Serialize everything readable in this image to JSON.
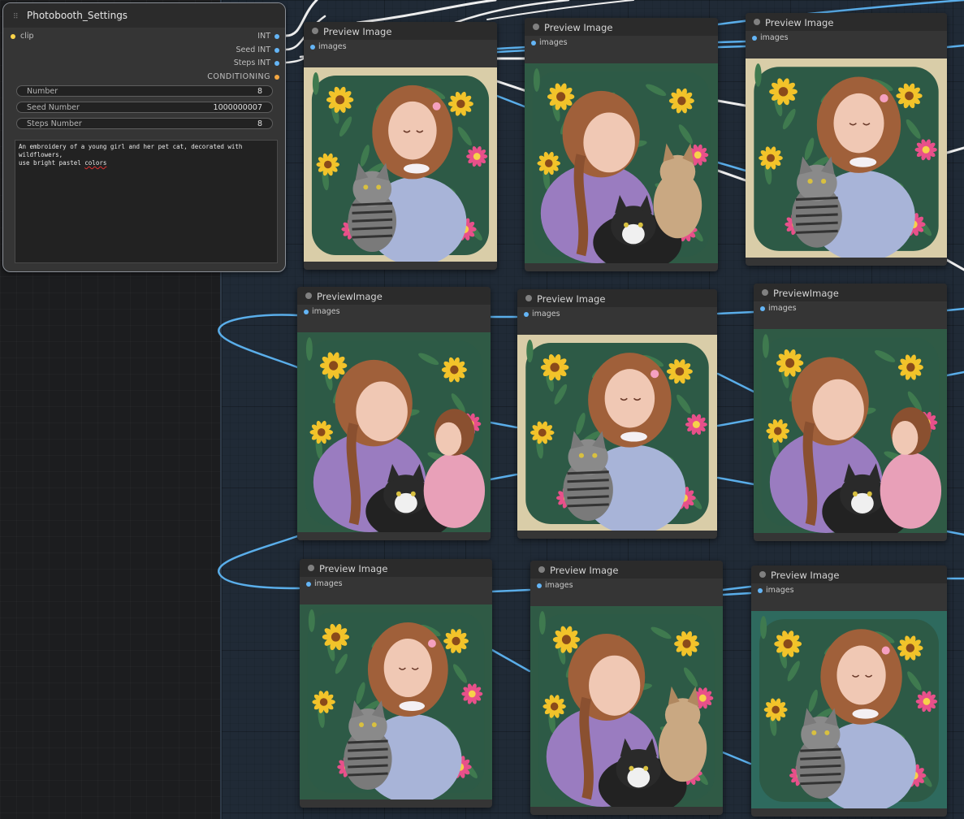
{
  "settings_node": {
    "title": "Photobooth_Settings",
    "input_port": "clip",
    "outputs": [
      "INT",
      "Seed INT",
      "Steps INT",
      "CONDITIONING"
    ],
    "widgets": [
      {
        "label": "Number",
        "value": "8"
      },
      {
        "label": "Seed Number",
        "value": "1000000007"
      },
      {
        "label": "Steps Number",
        "value": "8"
      }
    ],
    "prompt_line1": "An embroidery of a young girl and her pet cat, decorated with wildflowers,",
    "prompt_line2_pre": "use bright pastel ",
    "prompt_line2_err": "colors"
  },
  "preview_nodes": [
    {
      "title": "Preview Image",
      "input": "images",
      "variant": "girl-cat-tabby",
      "bg": "beige"
    },
    {
      "title": "Preview Image",
      "input": "images",
      "variant": "braid-kitten",
      "bg": "green"
    },
    {
      "title": "Preview Image",
      "input": "images",
      "variant": "girl-cat-tabby",
      "bg": "beige"
    },
    {
      "title": "PreviewImage",
      "input": "images",
      "variant": "braid-child",
      "bg": "green"
    },
    {
      "title": "Preview Image",
      "input": "images",
      "variant": "girl-cat-tabby",
      "bg": "beige"
    },
    {
      "title": "PreviewImage",
      "input": "images",
      "variant": "braid-child",
      "bg": "green"
    },
    {
      "title": "Preview Image",
      "input": "images",
      "variant": "girl-cat-tabby",
      "bg": "green"
    },
    {
      "title": "Preview Image",
      "input": "images",
      "variant": "braid-kitten",
      "bg": "green"
    },
    {
      "title": "Preview Image",
      "input": "images",
      "variant": "girl-cat-tabby",
      "bg": "teal"
    }
  ],
  "colors": {
    "int_port": "#64b5f6",
    "conditioning_port": "#f4a742",
    "clip_port": "#ffd54a",
    "link_blue": "#5aaeea",
    "link_white": "#f0f0f0"
  }
}
